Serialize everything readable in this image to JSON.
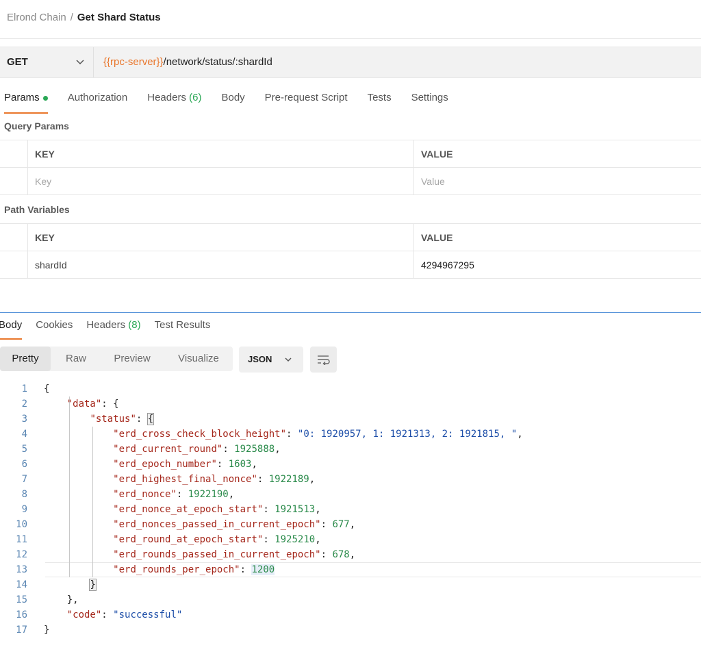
{
  "breadcrumb": {
    "parent": "Elrond Chain",
    "separator": "/",
    "current": "Get Shard Status"
  },
  "request": {
    "method": "GET",
    "url_variable": "{{rpc-server}}",
    "url_path": "/network/status/:shardId"
  },
  "request_tabs": [
    {
      "label": "Params",
      "active": true,
      "dot": true
    },
    {
      "label": "Authorization"
    },
    {
      "label": "Headers",
      "count": "(6)"
    },
    {
      "label": "Body"
    },
    {
      "label": "Pre-request Script"
    },
    {
      "label": "Tests"
    },
    {
      "label": "Settings"
    }
  ],
  "query_params": {
    "title": "Query Params",
    "headers": {
      "key": "KEY",
      "value": "VALUE"
    },
    "placeholders": {
      "key": "Key",
      "value": "Value"
    }
  },
  "path_variables": {
    "title": "Path Variables",
    "headers": {
      "key": "KEY",
      "value": "VALUE"
    },
    "rows": [
      {
        "key": "shardId",
        "value": "4294967295"
      }
    ]
  },
  "response_tabs": [
    {
      "label": "Body",
      "active": true
    },
    {
      "label": "Cookies"
    },
    {
      "label": "Headers",
      "count": "(8)"
    },
    {
      "label": "Test Results"
    }
  ],
  "view_modes": [
    "Pretty",
    "Raw",
    "Preview",
    "Visualize"
  ],
  "active_view": "Pretty",
  "format": "JSON",
  "code_lines": [
    {
      "n": "1",
      "tokens": [
        [
          "p",
          "{"
        ]
      ]
    },
    {
      "n": "2",
      "tokens": [
        [
          "p",
          "    "
        ],
        [
          "k",
          "\"data\""
        ],
        [
          "p",
          ": {"
        ]
      ]
    },
    {
      "n": "3",
      "tokens": [
        [
          "p",
          "        "
        ],
        [
          "k",
          "\"status\""
        ],
        [
          "p",
          ": "
        ],
        [
          "b",
          "{"
        ]
      ]
    },
    {
      "n": "4",
      "tokens": [
        [
          "p",
          "            "
        ],
        [
          "k",
          "\"erd_cross_check_block_height\""
        ],
        [
          "p",
          ": "
        ],
        [
          "s",
          "\"0: 1920957, 1: 1921313, 2: 1921815, \""
        ],
        [
          "p",
          ","
        ]
      ]
    },
    {
      "n": "5",
      "tokens": [
        [
          "p",
          "            "
        ],
        [
          "k",
          "\"erd_current_round\""
        ],
        [
          "p",
          ": "
        ],
        [
          "n",
          "1925888"
        ],
        [
          "p",
          ","
        ]
      ]
    },
    {
      "n": "6",
      "tokens": [
        [
          "p",
          "            "
        ],
        [
          "k",
          "\"erd_epoch_number\""
        ],
        [
          "p",
          ": "
        ],
        [
          "n",
          "1603"
        ],
        [
          "p",
          ","
        ]
      ]
    },
    {
      "n": "7",
      "tokens": [
        [
          "p",
          "            "
        ],
        [
          "k",
          "\"erd_highest_final_nonce\""
        ],
        [
          "p",
          ": "
        ],
        [
          "n",
          "1922189"
        ],
        [
          "p",
          ","
        ]
      ]
    },
    {
      "n": "8",
      "tokens": [
        [
          "p",
          "            "
        ],
        [
          "k",
          "\"erd_nonce\""
        ],
        [
          "p",
          ": "
        ],
        [
          "n",
          "1922190"
        ],
        [
          "p",
          ","
        ]
      ]
    },
    {
      "n": "9",
      "tokens": [
        [
          "p",
          "            "
        ],
        [
          "k",
          "\"erd_nonce_at_epoch_start\""
        ],
        [
          "p",
          ": "
        ],
        [
          "n",
          "1921513"
        ],
        [
          "p",
          ","
        ]
      ]
    },
    {
      "n": "10",
      "tokens": [
        [
          "p",
          "            "
        ],
        [
          "k",
          "\"erd_nonces_passed_in_current_epoch\""
        ],
        [
          "p",
          ": "
        ],
        [
          "n",
          "677"
        ],
        [
          "p",
          ","
        ]
      ]
    },
    {
      "n": "11",
      "tokens": [
        [
          "p",
          "            "
        ],
        [
          "k",
          "\"erd_round_at_epoch_start\""
        ],
        [
          "p",
          ": "
        ],
        [
          "n",
          "1925210"
        ],
        [
          "p",
          ","
        ]
      ]
    },
    {
      "n": "12",
      "tokens": [
        [
          "p",
          "            "
        ],
        [
          "k",
          "\"erd_rounds_passed_in_current_epoch\""
        ],
        [
          "p",
          ": "
        ],
        [
          "n",
          "678"
        ],
        [
          "p",
          ","
        ]
      ]
    },
    {
      "n": "13",
      "tokens": [
        [
          "p",
          "            "
        ],
        [
          "k",
          "\"erd_rounds_per_epoch\""
        ],
        [
          "p",
          ": "
        ],
        [
          "sel",
          "1200"
        ]
      ]
    },
    {
      "n": "14",
      "tokens": [
        [
          "p",
          "        "
        ],
        [
          "b",
          "}"
        ]
      ]
    },
    {
      "n": "15",
      "tokens": [
        [
          "p",
          "    },"
        ]
      ]
    },
    {
      "n": "16",
      "tokens": [
        [
          "p",
          "    "
        ],
        [
          "k",
          "\"code\""
        ],
        [
          "p",
          ": "
        ],
        [
          "s",
          "\"successful\""
        ]
      ]
    },
    {
      "n": "17",
      "tokens": [
        [
          "p",
          "}"
        ]
      ]
    }
  ],
  "colors": {
    "accent": "#e9762b",
    "success": "#2aa755",
    "key": "#a5271b",
    "string": "#1d4ea8",
    "number": "#2a8a4a"
  }
}
